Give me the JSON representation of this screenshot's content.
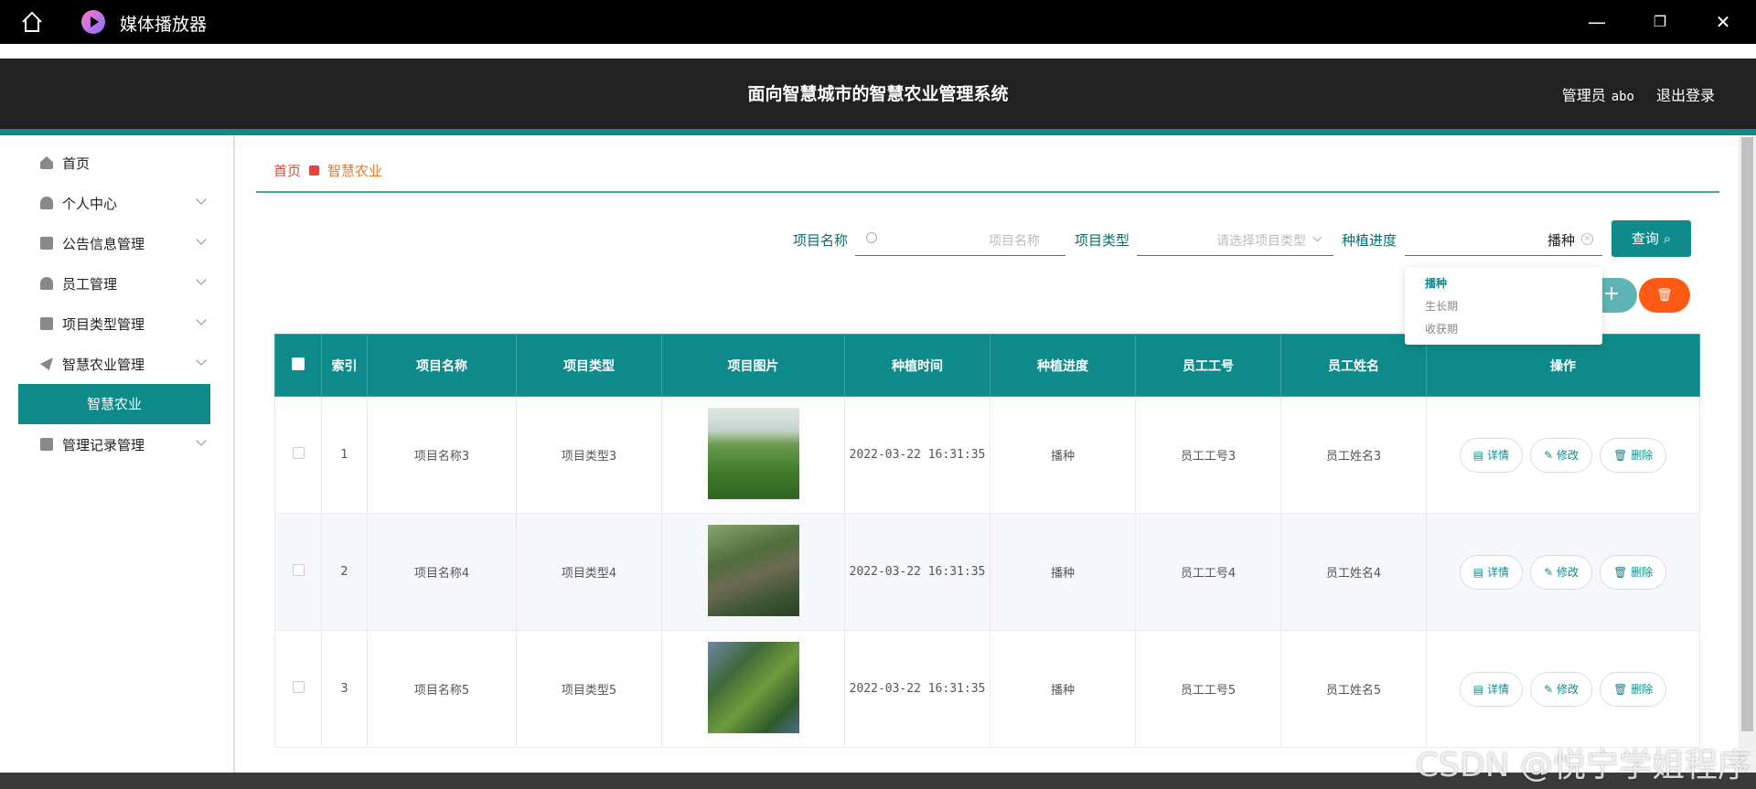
{
  "window": {
    "title": "媒体播放器"
  },
  "header": {
    "title": "面向智慧城市的智慧农业管理系统",
    "user_role": "管理员",
    "username": "abo",
    "logout": "退出登录"
  },
  "sidebar": {
    "items": [
      {
        "label": "首页",
        "icon": "home-icon"
      },
      {
        "label": "个人中心",
        "icon": "user-icon"
      },
      {
        "label": "公告信息管理",
        "icon": "clipboard-icon"
      },
      {
        "label": "员工管理",
        "icon": "user-icon"
      },
      {
        "label": "项目类型管理",
        "icon": "folder-icon"
      },
      {
        "label": "智慧农业管理",
        "icon": "send-icon"
      },
      {
        "label": "管理记录管理",
        "icon": "briefcase-icon"
      }
    ],
    "active_sub": "智慧农业"
  },
  "breadcrumb": {
    "home": "首页",
    "current": "智慧农业"
  },
  "search": {
    "name_label": "项目名称",
    "name_placeholder": "项目名称",
    "type_label": "项目类型",
    "type_placeholder": "请选择项目类型",
    "progress_label": "种植进度",
    "progress_value": "播种",
    "query_button": "查询"
  },
  "dropdown": {
    "options": [
      "播种",
      "生长期",
      "收获期"
    ]
  },
  "buttons": {
    "add": "+",
    "delete": "🗑"
  },
  "table": {
    "headers": [
      "索引",
      "项目名称",
      "项目类型",
      "项目图片",
      "种植时间",
      "种植进度",
      "员工工号",
      "员工姓名",
      "操作"
    ],
    "rows": [
      {
        "index": "1",
        "name": "项目名称3",
        "type": "项目类型3",
        "time": "2022-03-22 16:31:35",
        "progress": "播种",
        "emp_no": "员工工号3",
        "emp_name": "员工姓名3"
      },
      {
        "index": "2",
        "name": "项目名称4",
        "type": "项目类型4",
        "time": "2022-03-22 16:31:35",
        "progress": "播种",
        "emp_no": "员工工号4",
        "emp_name": "员工姓名4"
      },
      {
        "index": "3",
        "name": "项目名称5",
        "type": "项目类型5",
        "time": "2022-03-22 16:31:35",
        "progress": "播种",
        "emp_no": "员工工号5",
        "emp_name": "员工姓名5"
      }
    ],
    "ops": {
      "detail": "详情",
      "edit": "修改",
      "delete": "删除"
    }
  },
  "watermark": "CSDN @悦宁学姐程序",
  "colors": {
    "accent": "#0f8a8a",
    "danger": "#ff5a13",
    "breadcrumb": "#e2463b"
  }
}
